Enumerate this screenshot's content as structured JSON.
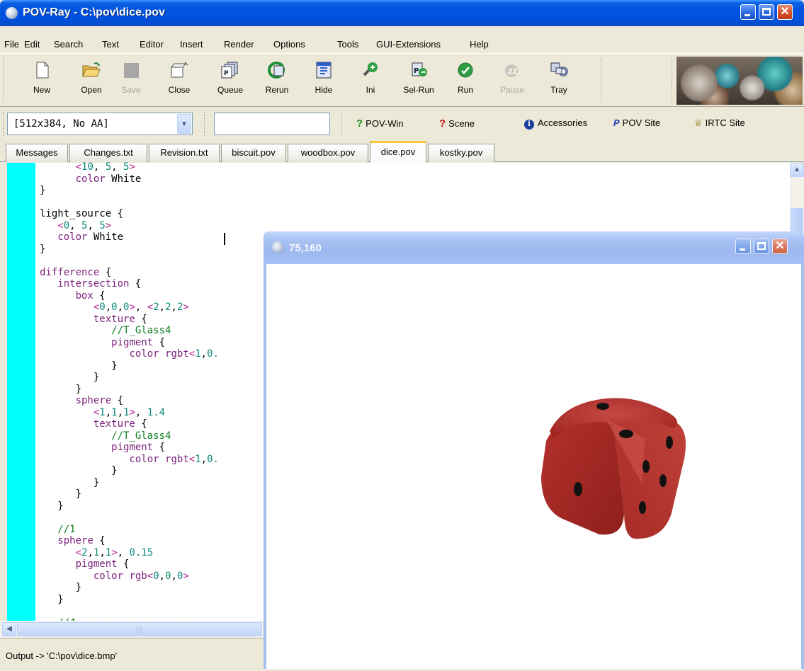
{
  "window": {
    "title": "POV-Ray - C:\\pov\\dice.pov"
  },
  "menu": [
    "File",
    "Edit",
    "Search",
    "Text",
    "Editor",
    "Insert",
    "Render",
    "Options",
    "Tools",
    "GUI-Extensions",
    "Help"
  ],
  "toolbar": {
    "new": "New",
    "open": "Open",
    "save": "Save",
    "close": "Close",
    "queue": "Queue",
    "rerun": "Rerun",
    "hide": "Hide",
    "ini": "Ini",
    "sel_run": "Sel-Run",
    "run": "Run",
    "pause": "Pause",
    "tray": "Tray"
  },
  "toolbar2": {
    "resolution": "[512x384, No AA]",
    "command_value": "",
    "pov_win": "POV-Win",
    "scene": "Scene",
    "accessories": "Accessories",
    "pov_site": "POV Site",
    "irtc_site": "IRTC Site"
  },
  "tabs": [
    "Messages",
    "Changes.txt",
    "Revision.txt",
    "biscuit.pov",
    "woodbox.pov",
    "dice.pov",
    "kostky.pov"
  ],
  "active_tab": "dice.pov",
  "render_window": {
    "title": "75,160"
  },
  "status": {
    "text": "Output -> 'C:\\pov\\dice.bmp'"
  },
  "colors": {
    "titlebar": "#0054E3",
    "gutter": "#00FFFF",
    "die": "#B22A26",
    "face": "#ECE9D8"
  },
  "icons": [
    "new-icon",
    "open-icon",
    "save-icon",
    "close-icon",
    "queue-icon",
    "rerun-icon",
    "hide-icon",
    "ini-icon",
    "sel-run-icon",
    "run-icon",
    "pause-icon",
    "tray-icon"
  ]
}
